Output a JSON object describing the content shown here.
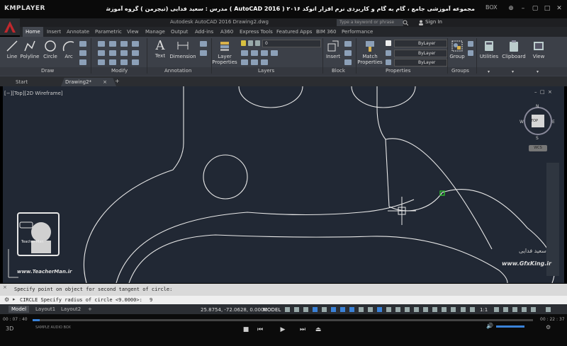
{
  "player": {
    "logo": "KMPLAYER",
    "video_title": "مجموعه آموزشی جامع ، گام به گام و کاربردی نرم افزار  اتوکد ۲۰۱۶ ( AutoCAD 2016 )  مدرس : سعید فدایی (تیچرمن ) گروه آموزشی پادشاه گرافیست ها",
    "box_label": "BOX",
    "time_elapsed": "00 : 07 : 40",
    "time_total": "00 : 22 : 37",
    "tags": "SAMPLE  AUDIO  BOX"
  },
  "app": {
    "window_title": "Autodesk AutoCAD 2016    Drawing2.dwg",
    "search_placeholder": "Type a keyword or phrase",
    "signin": "Sign In"
  },
  "ribbon": {
    "tabs": [
      "Home",
      "Insert",
      "Annotate",
      "Parametric",
      "View",
      "Manage",
      "Output",
      "Add-ins",
      "A360",
      "Express Tools",
      "Featured Apps",
      "BIM 360",
      "Performance"
    ],
    "draw": {
      "line": "Line",
      "polyline": "Polyline",
      "circle": "Circle",
      "arc": "Arc",
      "label": "Draw"
    },
    "modify_label": "Modify",
    "annotation": {
      "text": "Text",
      "dimension": "Dimension",
      "label": "Annotation"
    },
    "layers": {
      "layer_properties": "Layer Properties",
      "current_layer": "0",
      "label": "Layers"
    },
    "block": {
      "insert": "Insert",
      "label": "Block"
    },
    "properties": {
      "match": "Match Properties",
      "color": "ByLayer",
      "linetype": "ByLayer",
      "lineweight": "ByLayer",
      "label": "Properties"
    },
    "groups": {
      "group": "Group",
      "label": "Groups"
    },
    "utilities": "Utilities",
    "clipboard": "Clipboard",
    "view": "View"
  },
  "doc_tabs": {
    "start": "Start",
    "drawing": "Drawing2*"
  },
  "viewport": {
    "label": "[−][Top][2D Wireframe]",
    "cube_top": "TOP",
    "n": "N",
    "s": "S",
    "e": "E",
    "w": "W",
    "wcs": "WCS"
  },
  "command": {
    "history": "Specify point on object for second tangent of circle:",
    "prompt": "CIRCLE Specify radius of circle <9.0000>:",
    "input": "9"
  },
  "status": {
    "layout_tabs": [
      "Model",
      "Layout1",
      "Layout2"
    ],
    "coordinates": "25.8754, -72.0628, 0.0000",
    "model": "MODEL",
    "scale": "1:1"
  },
  "watermarks": {
    "teacher_url": "www.TeacherMan.ir",
    "teacher_label": "Teacher Man",
    "gfx": "www.GfxKing.ir",
    "gfx_sig": "سعید فدایی"
  },
  "colors": {
    "canvas": "#212834",
    "ribbon": "#3c4048",
    "accent": "#3a82d8",
    "acad_red": "#c0282d"
  }
}
